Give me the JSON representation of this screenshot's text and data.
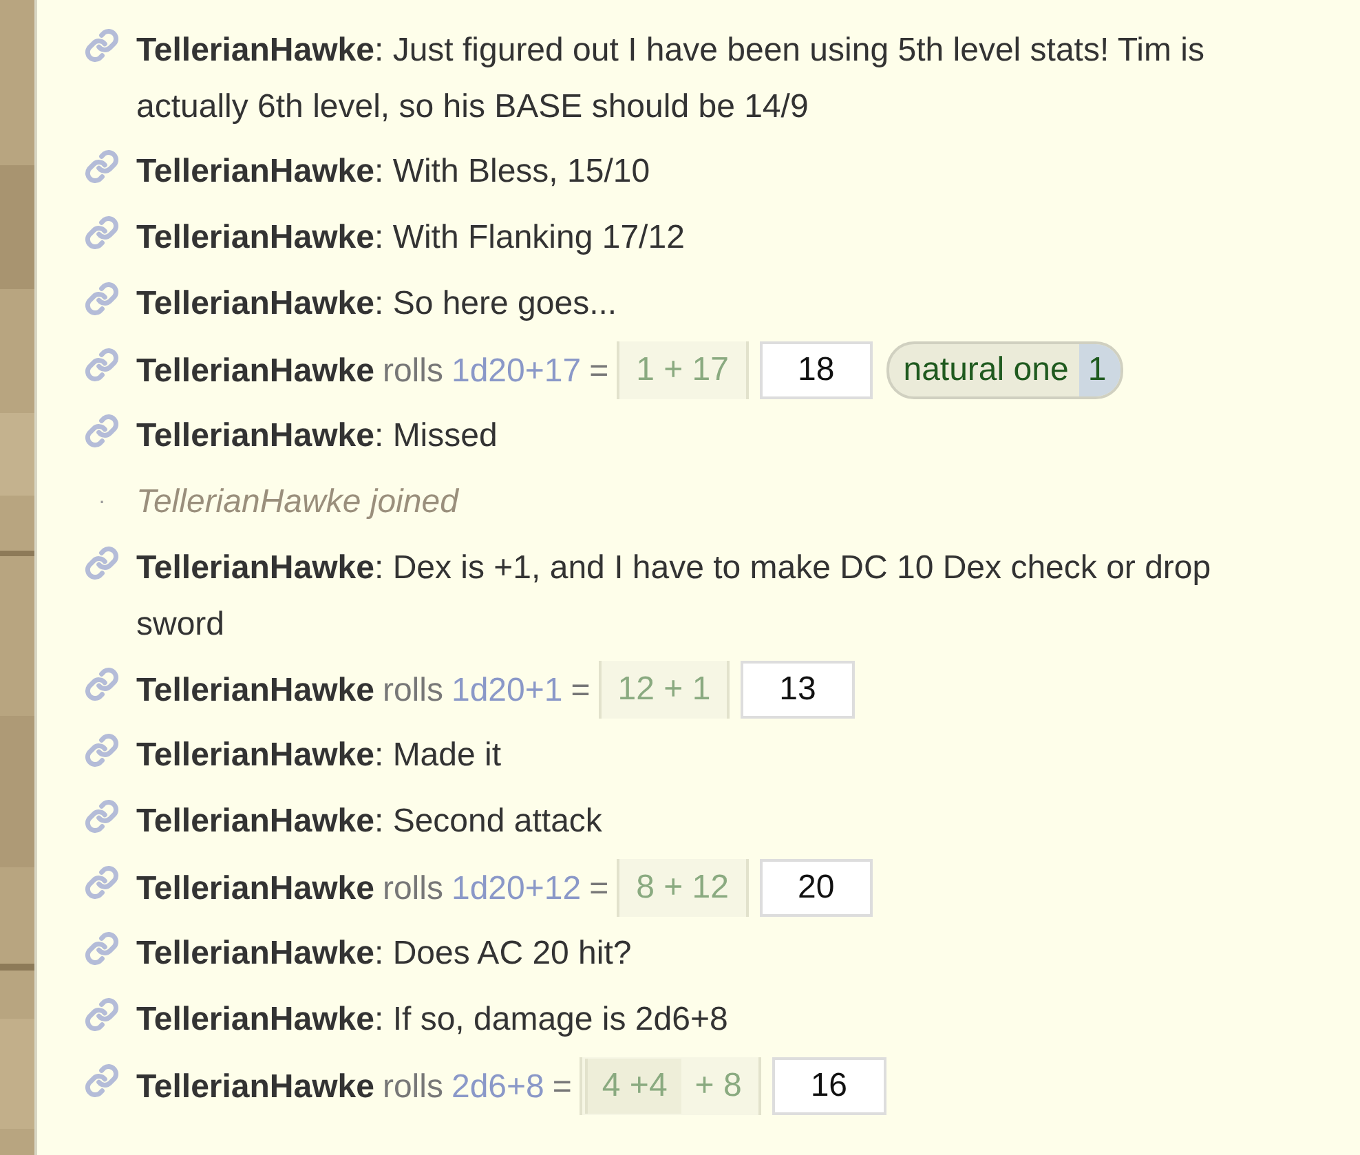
{
  "messages": [
    {
      "kind": "chat",
      "author": "TellerianHawke",
      "separator": ":",
      "text": "Just figured out I have been using 5th level stats! Tim is actually 6th level, so his BASE should be 14/9"
    },
    {
      "kind": "chat",
      "author": "TellerianHawke",
      "separator": ":",
      "text": "With Bless, 15/10"
    },
    {
      "kind": "chat",
      "author": "TellerianHawke",
      "separator": ":",
      "text": "With Flanking 17/12"
    },
    {
      "kind": "chat",
      "author": "TellerianHawke",
      "separator": ":",
      "text": "So here goes..."
    },
    {
      "kind": "roll",
      "author": "TellerianHawke",
      "verb": "rolls",
      "formula": "1d20+17",
      "equals": "=",
      "parts": [
        {
          "kind": "group",
          "text": "1 + 17"
        }
      ],
      "total": "18",
      "tags": [
        {
          "label": "natural one",
          "value": "1"
        }
      ]
    },
    {
      "kind": "chat",
      "author": "TellerianHawke",
      "separator": ":",
      "text": "Missed"
    },
    {
      "kind": "system",
      "bullet": "·",
      "text": "TellerianHawke joined"
    },
    {
      "kind": "chat",
      "author": "TellerianHawke",
      "separator": ":",
      "text": "Dex is +1, and I have to make DC 10 Dex check or drop sword"
    },
    {
      "kind": "roll",
      "author": "TellerianHawke",
      "verb": "rolls",
      "formula": "1d20+1",
      "equals": "=",
      "parts": [
        {
          "kind": "group",
          "text": "12 + 1"
        }
      ],
      "total": "13"
    },
    {
      "kind": "chat",
      "author": "TellerianHawke",
      "separator": ":",
      "text": "Made it"
    },
    {
      "kind": "chat",
      "author": "TellerianHawke",
      "separator": ":",
      "text": "Second attack"
    },
    {
      "kind": "roll",
      "author": "TellerianHawke",
      "verb": "rolls",
      "formula": "1d20+12",
      "equals": "=",
      "parts": [
        {
          "kind": "group",
          "text": "8 + 12"
        }
      ],
      "total": "20"
    },
    {
      "kind": "chat",
      "author": "TellerianHawke",
      "separator": ":",
      "text": "Does AC 20 hit?"
    },
    {
      "kind": "chat",
      "author": "TellerianHawke",
      "separator": ":",
      "text": "If so, damage is 2d6+8"
    },
    {
      "kind": "roll",
      "author": "TellerianHawke",
      "verb": "rolls",
      "formula": "2d6+8",
      "equals": "=",
      "parts": [
        {
          "kind": "dice",
          "text": "4 +4"
        },
        {
          "kind": "mod",
          "text": "+ 8"
        }
      ],
      "total": "16"
    }
  ]
}
